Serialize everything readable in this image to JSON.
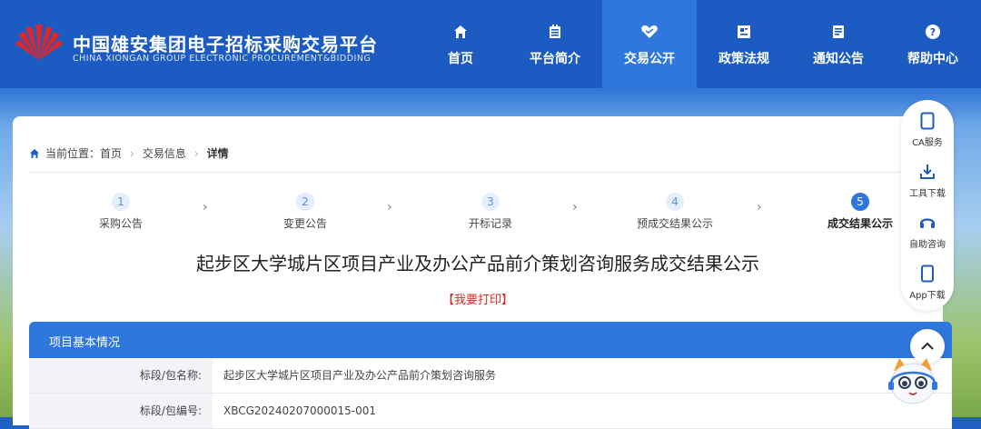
{
  "brand": {
    "name_cn": "中国雄安集团电子招标采购交易平台",
    "name_en": "CHINA XIONGAN GROUP ELECTRONIC PROCUREMENT&BIDDING"
  },
  "nav": [
    {
      "label": "首页",
      "icon": "home-icon"
    },
    {
      "label": "平台简介",
      "icon": "building-icon"
    },
    {
      "label": "交易公开",
      "icon": "handshake-icon",
      "active": true
    },
    {
      "label": "政策法规",
      "icon": "document-icon"
    },
    {
      "label": "通知公告",
      "icon": "notice-icon"
    },
    {
      "label": "帮助中心",
      "icon": "help-icon"
    }
  ],
  "breadcrumb": {
    "prefix": "当前位置：",
    "items": [
      "首页",
      "交易信息",
      "详情"
    ]
  },
  "steps": [
    {
      "num": "1",
      "label": "采购公告"
    },
    {
      "num": "2",
      "label": "变更公告"
    },
    {
      "num": "3",
      "label": "开标记录"
    },
    {
      "num": "4",
      "label": "预成交结果公示"
    },
    {
      "num": "5",
      "label": "成交结果公示",
      "active": true
    }
  ],
  "page_title": "起步区大学城片区项目产业及办公产品前介策划咨询服务成交结果公示",
  "print_label": "【我要打印】",
  "section": {
    "title": "项目基本情况",
    "rows": [
      {
        "key": "标段/包名称:",
        "value": "起步区大学城片区项目产业及办公产品前介策划咨询服务"
      },
      {
        "key": "标段/包编号:",
        "value": "XBCG20240207000015-001"
      }
    ]
  },
  "side_panel": [
    {
      "label": "CA服务",
      "icon": "ca-card-icon"
    },
    {
      "label": "工具下载",
      "icon": "download-icon"
    },
    {
      "label": "自助咨询",
      "icon": "headset-icon"
    },
    {
      "label": "App下载",
      "icon": "phone-icon"
    }
  ],
  "colors": {
    "header_bg": "#1c5cc2",
    "accent": "#2f77dc",
    "print_red": "#d0302a",
    "logo_red": "#d9282f"
  }
}
